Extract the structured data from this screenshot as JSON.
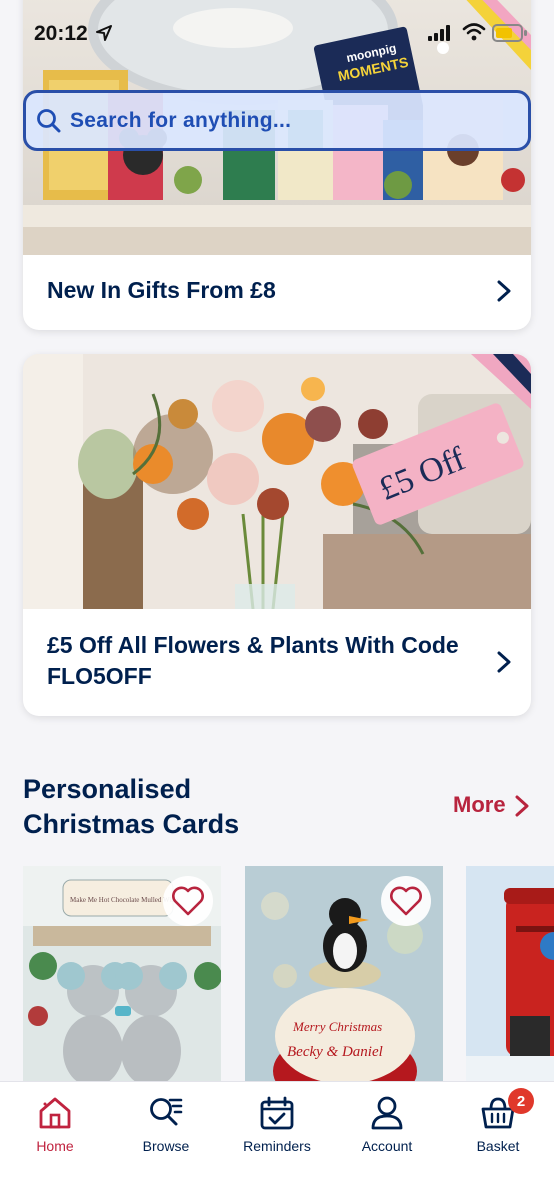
{
  "status_bar": {
    "time": "20:12"
  },
  "search": {
    "placeholder": "Search for anything..."
  },
  "promo_cards": [
    {
      "title": "New In Gifts From £8",
      "banner_text": [
        "moonpig",
        "MOMENTS"
      ]
    },
    {
      "title": "£5 Off All Flowers & Plants With Code FLO5OFF",
      "tag_text": "£5 Off"
    }
  ],
  "section": {
    "title": "Personalised Christmas Cards",
    "more_label": "More"
  },
  "products": [
    {
      "art_text": [
        "Make Me Hot Chocolate Mulled Wine"
      ]
    },
    {
      "art_text": [
        "Merry Christmas",
        "Becky & Daniel"
      ]
    },
    {
      "art_text": []
    }
  ],
  "tabs": [
    {
      "label": "Home",
      "icon": "home-icon",
      "active": true
    },
    {
      "label": "Browse",
      "icon": "browse-icon",
      "active": false
    },
    {
      "label": "Reminders",
      "icon": "calendar-icon",
      "active": false
    },
    {
      "label": "Account",
      "icon": "person-icon",
      "active": false
    },
    {
      "label": "Basket",
      "icon": "basket-icon",
      "active": false,
      "badge": "2"
    }
  ],
  "colors": {
    "navy": "#00204e",
    "accent_red": "#c0233f",
    "search_border": "#2a4fa8",
    "badge": "#e0382b"
  }
}
